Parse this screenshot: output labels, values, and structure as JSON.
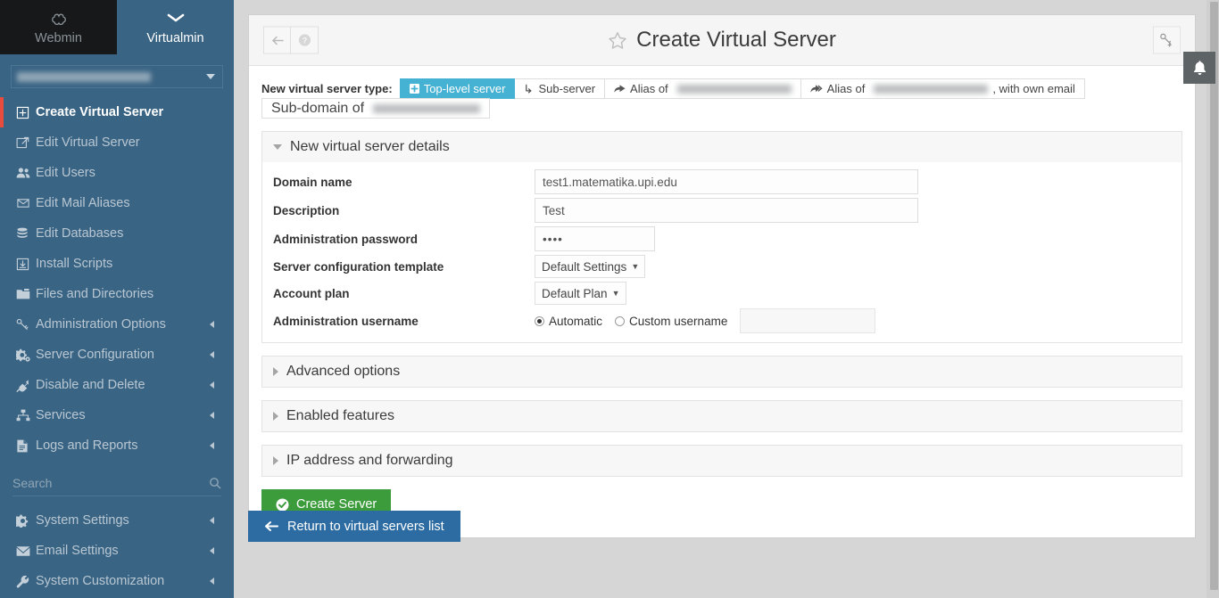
{
  "sidebar": {
    "brand_tabs": [
      {
        "label": "Webmin",
        "icon": "webmin-logo-icon",
        "active": false
      },
      {
        "label": "Virtualmin",
        "icon": "chevron-down-icon",
        "active": true
      }
    ],
    "server_select": {
      "value": "",
      "redacted": true
    },
    "items": [
      {
        "label": "Create Virtual Server",
        "icon": "plus-square-icon",
        "active": true,
        "submenu": false
      },
      {
        "label": "Edit Virtual Server",
        "icon": "edit-icon",
        "active": false,
        "submenu": false
      },
      {
        "label": "Edit Users",
        "icon": "users-icon",
        "active": false,
        "submenu": false
      },
      {
        "label": "Edit Mail Aliases",
        "icon": "envelope-icon",
        "active": false,
        "submenu": false
      },
      {
        "label": "Edit Databases",
        "icon": "database-icon",
        "active": false,
        "submenu": false
      },
      {
        "label": "Install Scripts",
        "icon": "download-box-icon",
        "active": false,
        "submenu": false
      },
      {
        "label": "Files and Directories",
        "icon": "folder-icon",
        "active": false,
        "submenu": false
      },
      {
        "label": "Administration Options",
        "icon": "key-icon",
        "active": false,
        "submenu": true
      },
      {
        "label": "Server Configuration",
        "icon": "cogs-icon",
        "active": false,
        "submenu": true
      },
      {
        "label": "Disable and Delete",
        "icon": "plug-icon",
        "active": false,
        "submenu": true
      },
      {
        "label": "Services",
        "icon": "sitemap-icon",
        "active": false,
        "submenu": true
      },
      {
        "label": "Logs and Reports",
        "icon": "file-text-icon",
        "active": false,
        "submenu": true
      }
    ],
    "search": {
      "placeholder": "Search",
      "value": "",
      "icon": "search-icon"
    },
    "bottom_items": [
      {
        "label": "System Settings",
        "icon": "gear-icon",
        "submenu": true
      },
      {
        "label": "Email Settings",
        "icon": "envelope-filled-icon",
        "submenu": true
      },
      {
        "label": "System Customization",
        "icon": "wrench-icon",
        "submenu": true
      }
    ]
  },
  "header": {
    "back_icon": "arrow-left-icon",
    "help_icon": "question-circle-icon",
    "favorite_icon": "star-outline-icon",
    "title": "Create Virtual Server",
    "right_icon": "key-plus-icon"
  },
  "type_selector": {
    "label": "New virtual server type:",
    "tabs": [
      {
        "label": "Top-level server",
        "icon": "plus-square-filled-icon",
        "active": true,
        "redacted": false,
        "suffix": ""
      },
      {
        "label": "Sub-server",
        "icon": "level-down-icon",
        "active": false,
        "redacted": false,
        "suffix": ""
      },
      {
        "label": "Alias of",
        "icon": "share-arrow-icon",
        "active": false,
        "redacted": true,
        "suffix": ""
      },
      {
        "label": "Alias of",
        "icon": "share-arrow-double-icon",
        "active": false,
        "redacted": true,
        "suffix": ", with own email"
      },
      {
        "label": "Sub-domain of",
        "icon": "",
        "active": false,
        "redacted": true,
        "suffix": ""
      }
    ]
  },
  "details_section": {
    "title": "New virtual server details",
    "expanded": true,
    "fields": {
      "domain_name": {
        "label": "Domain name",
        "value": "test1.matematika.upi.edu",
        "placeholder": ""
      },
      "description": {
        "label": "Description",
        "value": "Test",
        "placeholder": ""
      },
      "admin_password": {
        "label": "Administration password",
        "value": "••••",
        "placeholder": ""
      },
      "config_template": {
        "label": "Server configuration template",
        "value": "Default Settings",
        "options": [
          "Default Settings"
        ]
      },
      "account_plan": {
        "label": "Account plan",
        "value": "Default Plan",
        "options": [
          "Default Plan"
        ]
      },
      "admin_username": {
        "label": "Administration username",
        "options": [
          {
            "label": "Automatic",
            "selected": true
          },
          {
            "label": "Custom username",
            "selected": false
          }
        ],
        "custom_value": ""
      }
    }
  },
  "collapsed_sections": [
    {
      "title": "Advanced options",
      "expanded": false
    },
    {
      "title": "Enabled features",
      "expanded": false
    },
    {
      "title": "IP address and forwarding",
      "expanded": false
    }
  ],
  "buttons": {
    "create_server": {
      "label": "Create Server",
      "icon": "check-circle-icon"
    },
    "return_list": {
      "label": "Return to virtual servers list",
      "icon": "arrow-left-icon"
    }
  },
  "notification": {
    "icon": "bell-icon"
  },
  "colors": {
    "sidebar_bg": "#3a6484",
    "webmin_tab_bg": "#16181a",
    "active_accent": "#e74c3c",
    "tab_active": "#45b2d3",
    "create_green": "#3c9c3c",
    "return_blue": "#2d6ca2",
    "page_bg": "#d6d6d6"
  }
}
